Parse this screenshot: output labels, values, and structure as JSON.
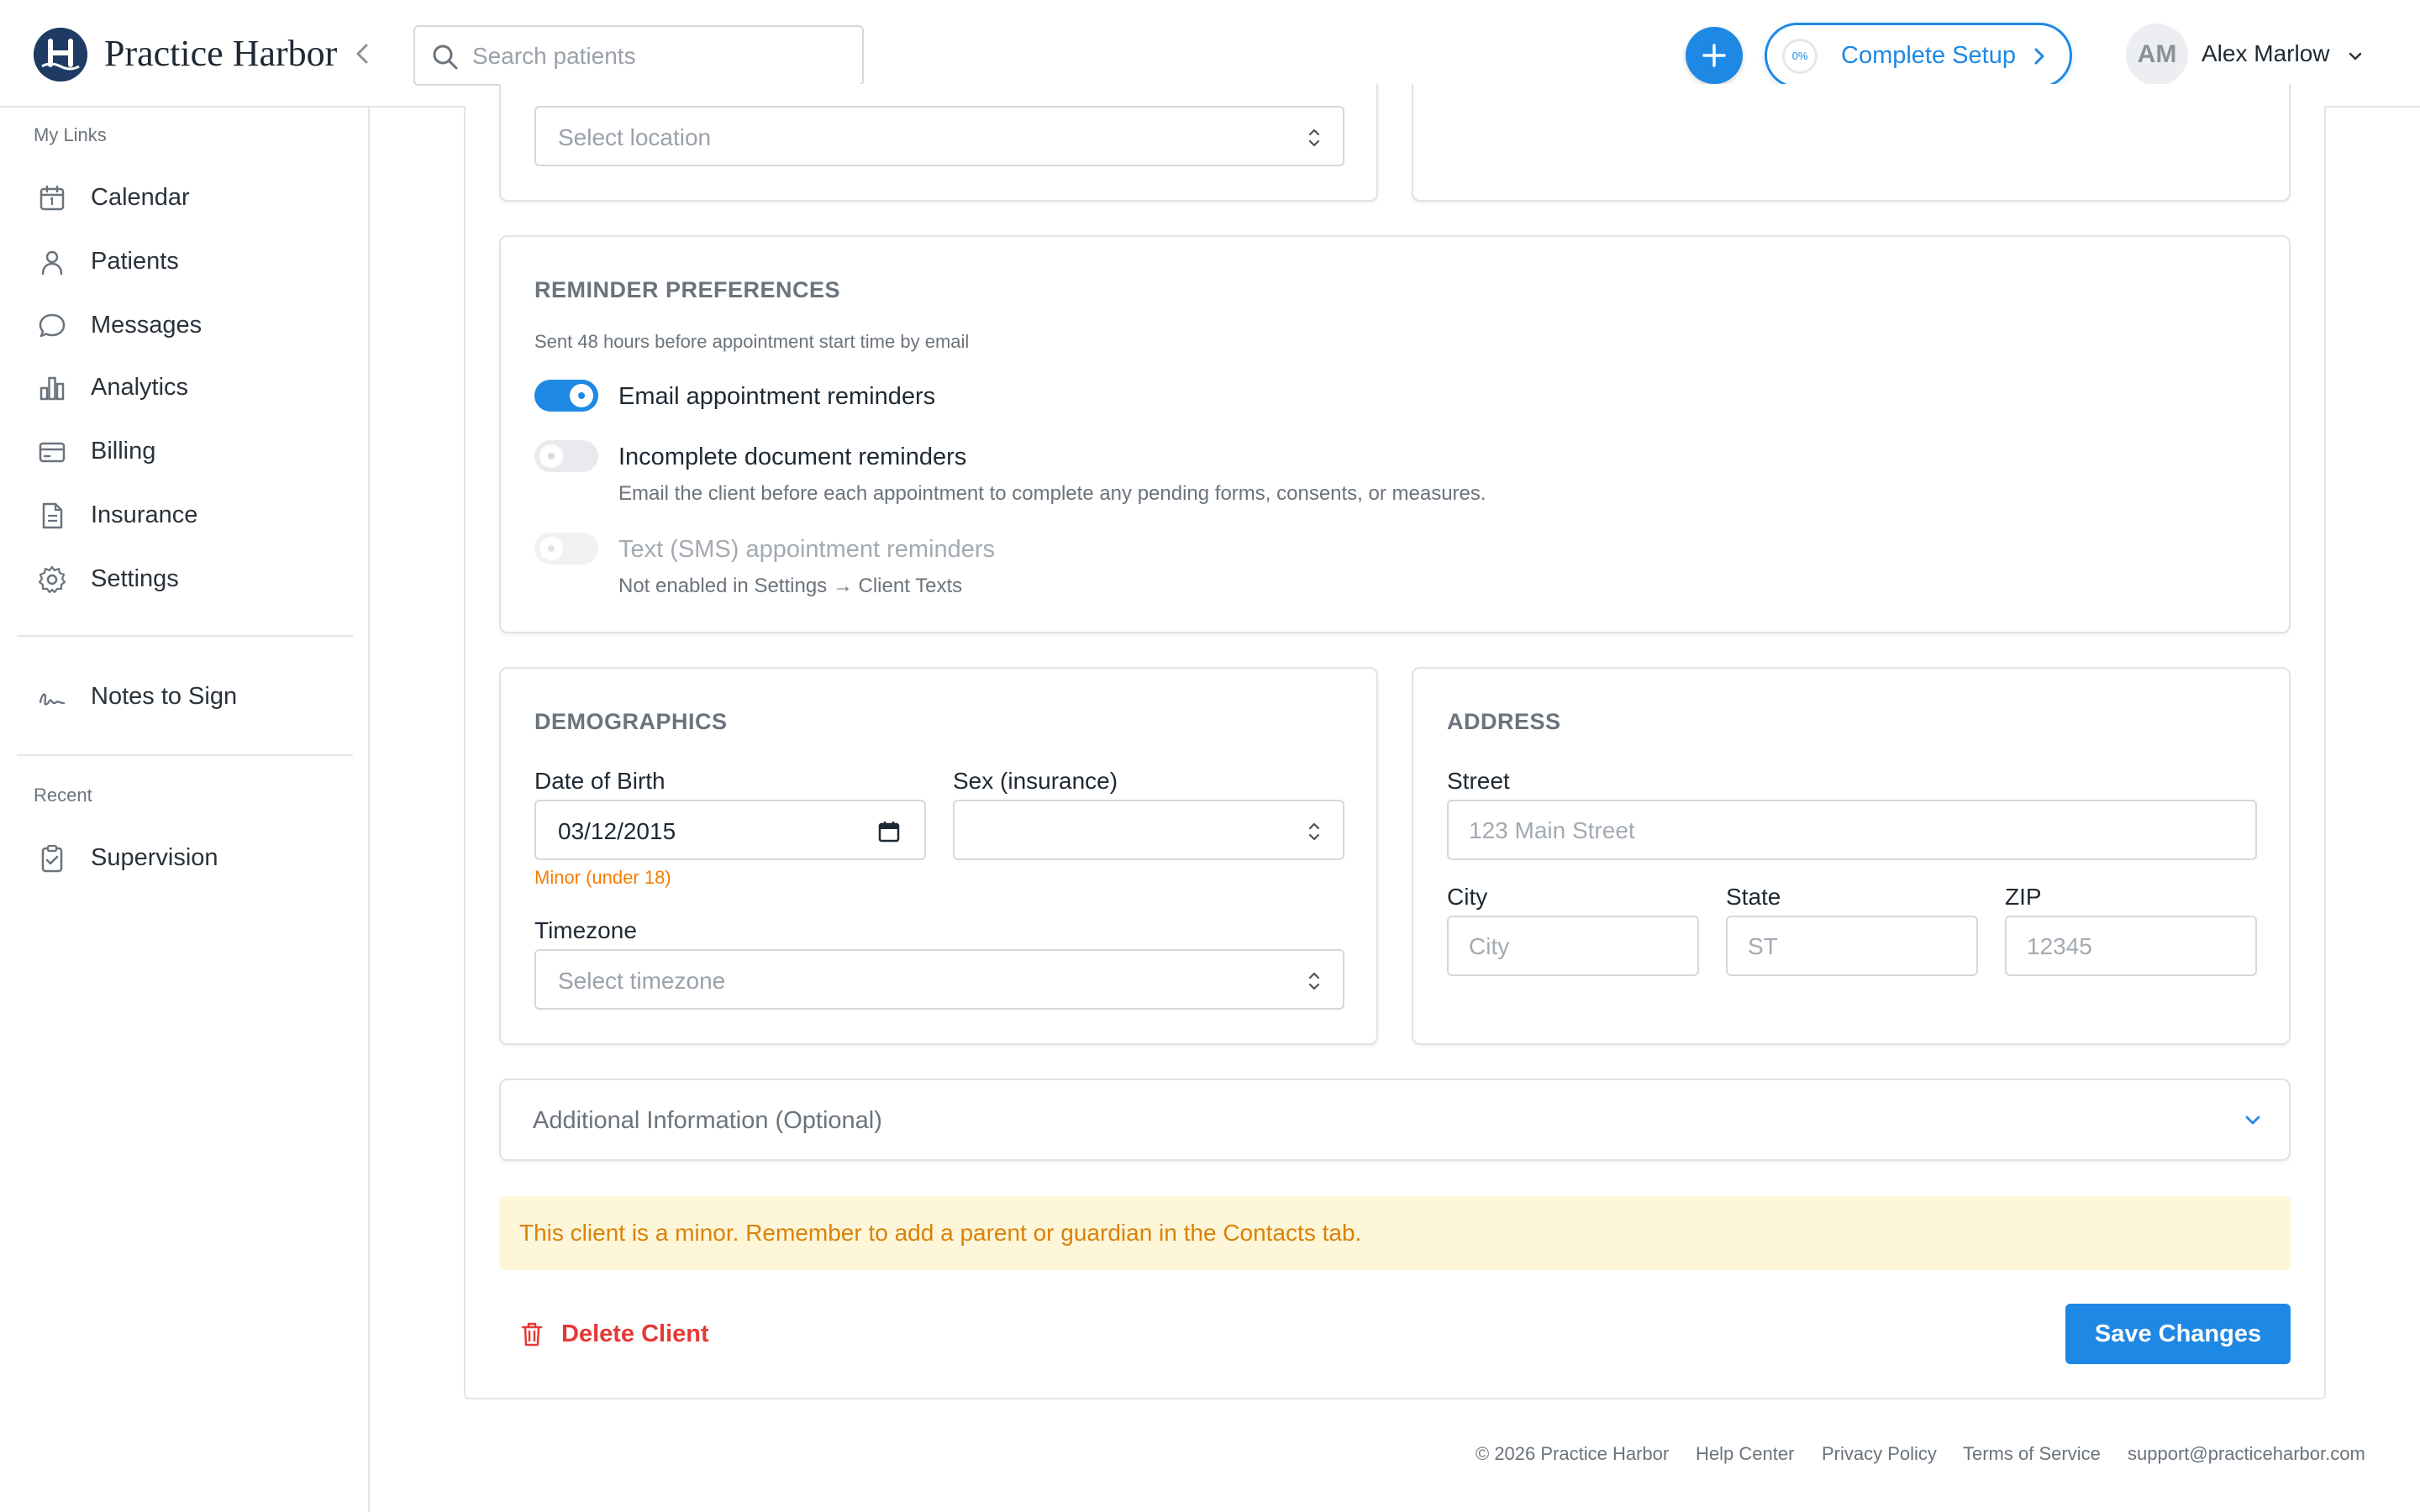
{
  "header": {
    "brand": "Practice Harbor",
    "search_placeholder": "Search patients",
    "setup_progress": "0%",
    "setup_label": "Complete Setup",
    "avatar_initials": "AM",
    "user_name": "Alex Marlow"
  },
  "sidebar": {
    "my_links_label": "My Links",
    "items": [
      {
        "label": "Calendar",
        "icon": "calendar-icon"
      },
      {
        "label": "Patients",
        "icon": "person-icon"
      },
      {
        "label": "Messages",
        "icon": "chat-icon"
      },
      {
        "label": "Analytics",
        "icon": "bar-chart-icon"
      },
      {
        "label": "Billing",
        "icon": "credit-card-icon"
      },
      {
        "label": "Insurance",
        "icon": "document-icon"
      },
      {
        "label": "Settings",
        "icon": "gear-icon"
      }
    ],
    "notes_to_sign": "Notes to Sign",
    "recent_label": "Recent",
    "recent_items": [
      {
        "label": "Supervision",
        "icon": "clipboard-check-icon"
      }
    ]
  },
  "location": {
    "placeholder": "Select location"
  },
  "reminders": {
    "title": "REMINDER PREFERENCES",
    "subtitle": "Sent 48 hours before appointment start time by email",
    "email": {
      "label": "Email appointment reminders",
      "enabled": true
    },
    "incomplete": {
      "label": "Incomplete document reminders",
      "desc": "Email the client before each appointment to complete any pending forms, consents, or measures.",
      "enabled": false
    },
    "sms": {
      "label": "Text (SMS) appointment reminders",
      "desc": "Not enabled in Settings → Client Texts",
      "enabled": false,
      "disabled": true
    }
  },
  "demographics": {
    "title": "DEMOGRAPHICS",
    "dob_label": "Date of Birth",
    "dob_value": "03/12/2015",
    "minor_note": "Minor (under 18)",
    "sex_label": "Sex (insurance)",
    "sex_value": "",
    "timezone_label": "Timezone",
    "timezone_placeholder": "Select timezone"
  },
  "address": {
    "title": "ADDRESS",
    "street_label": "Street",
    "street_placeholder": "123 Main Street",
    "city_label": "City",
    "city_placeholder": "City",
    "state_label": "State",
    "state_placeholder": "ST",
    "zip_label": "ZIP",
    "zip_placeholder": "12345"
  },
  "additional": {
    "label": "Additional Information (Optional)"
  },
  "banner": {
    "text": "This client is a minor. Remember to add a parent or guardian in the Contacts tab."
  },
  "actions": {
    "delete_label": "Delete Client",
    "save_label": "Save Changes"
  },
  "footer": {
    "copyright": "© 2026 Practice Harbor",
    "links": [
      "Help Center",
      "Privacy Policy",
      "Terms of Service",
      "support@practiceharbor.com"
    ]
  },
  "colors": {
    "accent": "#1e88e5",
    "danger": "#e53935",
    "warning_text": "#d9820a",
    "warning_bg": "#fdf6d9",
    "brand_navy": "#1f3b63"
  }
}
